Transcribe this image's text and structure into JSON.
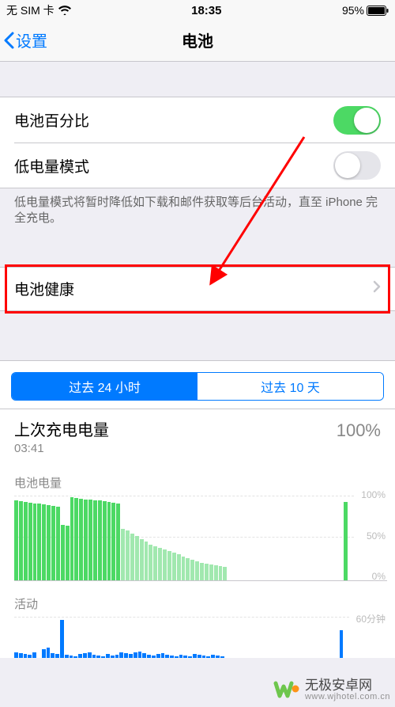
{
  "status": {
    "carrier": "无 SIM 卡",
    "time": "18:35",
    "battery_pct": "95%"
  },
  "nav": {
    "back_label": "设置",
    "title": "电池"
  },
  "rows": {
    "battery_percent_label": "电池百分比",
    "low_power_label": "低电量模式",
    "low_power_note": "低电量模式将暂时降低如下载和邮件获取等后台活动，直至 iPhone 完全充电。",
    "battery_health_label": "电池健康"
  },
  "segmented": {
    "opt24h": "过去 24 小时",
    "opt10d": "过去 10 天",
    "active": 0
  },
  "last_charge": {
    "title": "上次充电电量",
    "time": "03:41",
    "pct": "100%"
  },
  "chart_data": [
    {
      "type": "bar",
      "title": "电池电量",
      "ylabel": "",
      "xlabel": "",
      "ylim": [
        0,
        100
      ],
      "y_ticks": [
        "100%",
        "50%",
        "0%"
      ],
      "values": [
        94,
        93,
        92,
        91,
        90,
        90,
        89,
        88,
        87,
        86,
        65,
        64,
        98,
        97,
        96,
        95,
        95,
        94,
        94,
        93,
        92,
        91,
        90,
        60,
        58,
        55,
        52,
        48,
        45,
        42,
        40,
        38,
        36,
        34,
        32,
        30,
        28,
        26,
        24,
        22,
        20,
        19,
        18,
        17,
        16,
        15,
        0,
        0,
        0,
        0,
        0,
        0,
        0,
        0,
        0,
        0,
        0,
        0,
        0,
        0,
        0,
        0,
        0,
        0,
        0,
        0,
        0,
        0,
        0,
        0,
        0,
        92,
        0
      ]
    },
    {
      "type": "bar",
      "title": "活动",
      "ylabel": "",
      "xlabel": "",
      "ylim": [
        0,
        60
      ],
      "y_ticks": [
        "60分钟"
      ],
      "values": [
        8,
        6,
        5,
        4,
        7,
        0,
        12,
        14,
        6,
        5,
        55,
        4,
        3,
        2,
        5,
        6,
        7,
        4,
        3,
        2,
        5,
        3,
        4,
        8,
        6,
        5,
        7,
        9,
        6,
        4,
        3,
        5,
        6,
        4,
        3,
        2,
        4,
        3,
        2,
        5,
        4,
        3,
        2,
        4,
        3,
        2,
        0,
        0,
        0,
        0,
        0,
        0,
        0,
        0,
        0,
        0,
        0,
        0,
        0,
        0,
        0,
        0,
        0,
        0,
        0,
        0,
        0,
        0,
        0,
        0,
        0,
        40,
        0
      ]
    }
  ],
  "watermark": {
    "line1": "无极安卓网",
    "line2": "www.wjhotel.com.cn"
  },
  "colors": {
    "ios_blue": "#007aff",
    "ios_green": "#4cd964",
    "annotation_red": "#ff0000"
  }
}
